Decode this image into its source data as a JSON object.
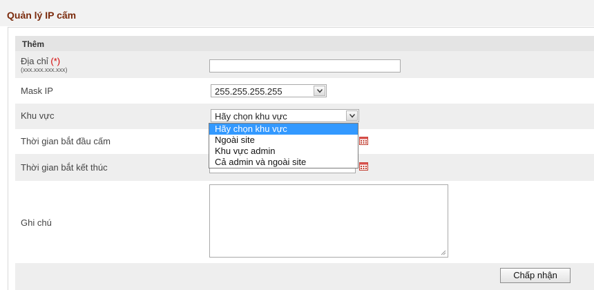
{
  "page": {
    "title": "Quản lý IP cấm"
  },
  "form": {
    "section_title": "Thêm",
    "address": {
      "label": "Địa chỉ",
      "required_mark": "(*)",
      "note": "(xxx.xxx.xxx.xxx)",
      "value": ""
    },
    "mask": {
      "label": "Mask IP",
      "selected": "255.255.255.255"
    },
    "region": {
      "label": "Khu vực",
      "selected": "Hãy chọn khu vực",
      "options": [
        "Hãy chọn khu vực",
        "Ngoài site",
        "Khu vực admin",
        "Cả admin và ngoài site"
      ],
      "highlighted_index": 0
    },
    "start_time": {
      "label": "Thời gian bắt đầu cấm"
    },
    "end_time": {
      "label": "Thời gian bắt kết thúc"
    },
    "note": {
      "label": "Ghi chú",
      "value": ""
    },
    "submit_label": "Chấp nhận"
  },
  "colors": {
    "title": "#7a2a0c",
    "required": "#d40000",
    "row_gray": "#eeeeee",
    "option_highlight": "#3399ff"
  },
  "icons": [
    "calendar-icon",
    "chevron-down-icon",
    "resize-grip-icon"
  ]
}
